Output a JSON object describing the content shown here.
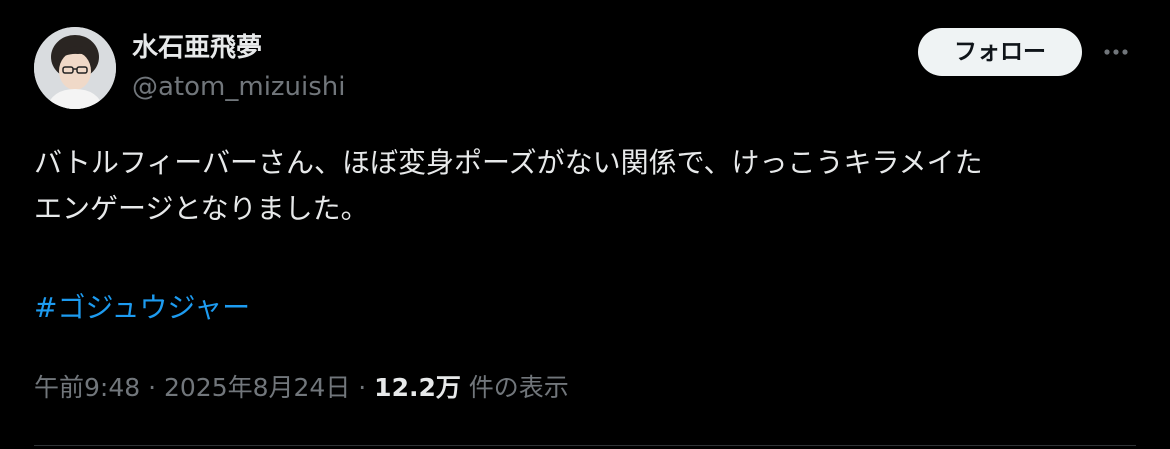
{
  "author": {
    "display_name": "水石亜飛夢",
    "handle": "@atom_mizuishi",
    "avatar_icon": "profile-photo"
  },
  "header": {
    "follow_label": "フォロー",
    "more_icon": "more-horizontal-icon"
  },
  "tweet": {
    "text_lines": [
      "バトルフィーバーさん、ほぼ変身ポーズがない関係で、けっこうキラメイた",
      "エンゲージとなりました。"
    ],
    "hashtag": "#ゴジュウジャー"
  },
  "meta": {
    "time": "午前9:48",
    "separator_1": " · ",
    "date": "2025年8月24日",
    "separator_2": " · ",
    "views_count": "12.2万",
    "views_label": " 件の表示"
  },
  "colors": {
    "background": "#000000",
    "text_primary": "#e7e9ea",
    "text_secondary": "#71767b",
    "link": "#1d9bf0",
    "follow_bg": "#eff3f4",
    "divider": "#2f3336"
  }
}
